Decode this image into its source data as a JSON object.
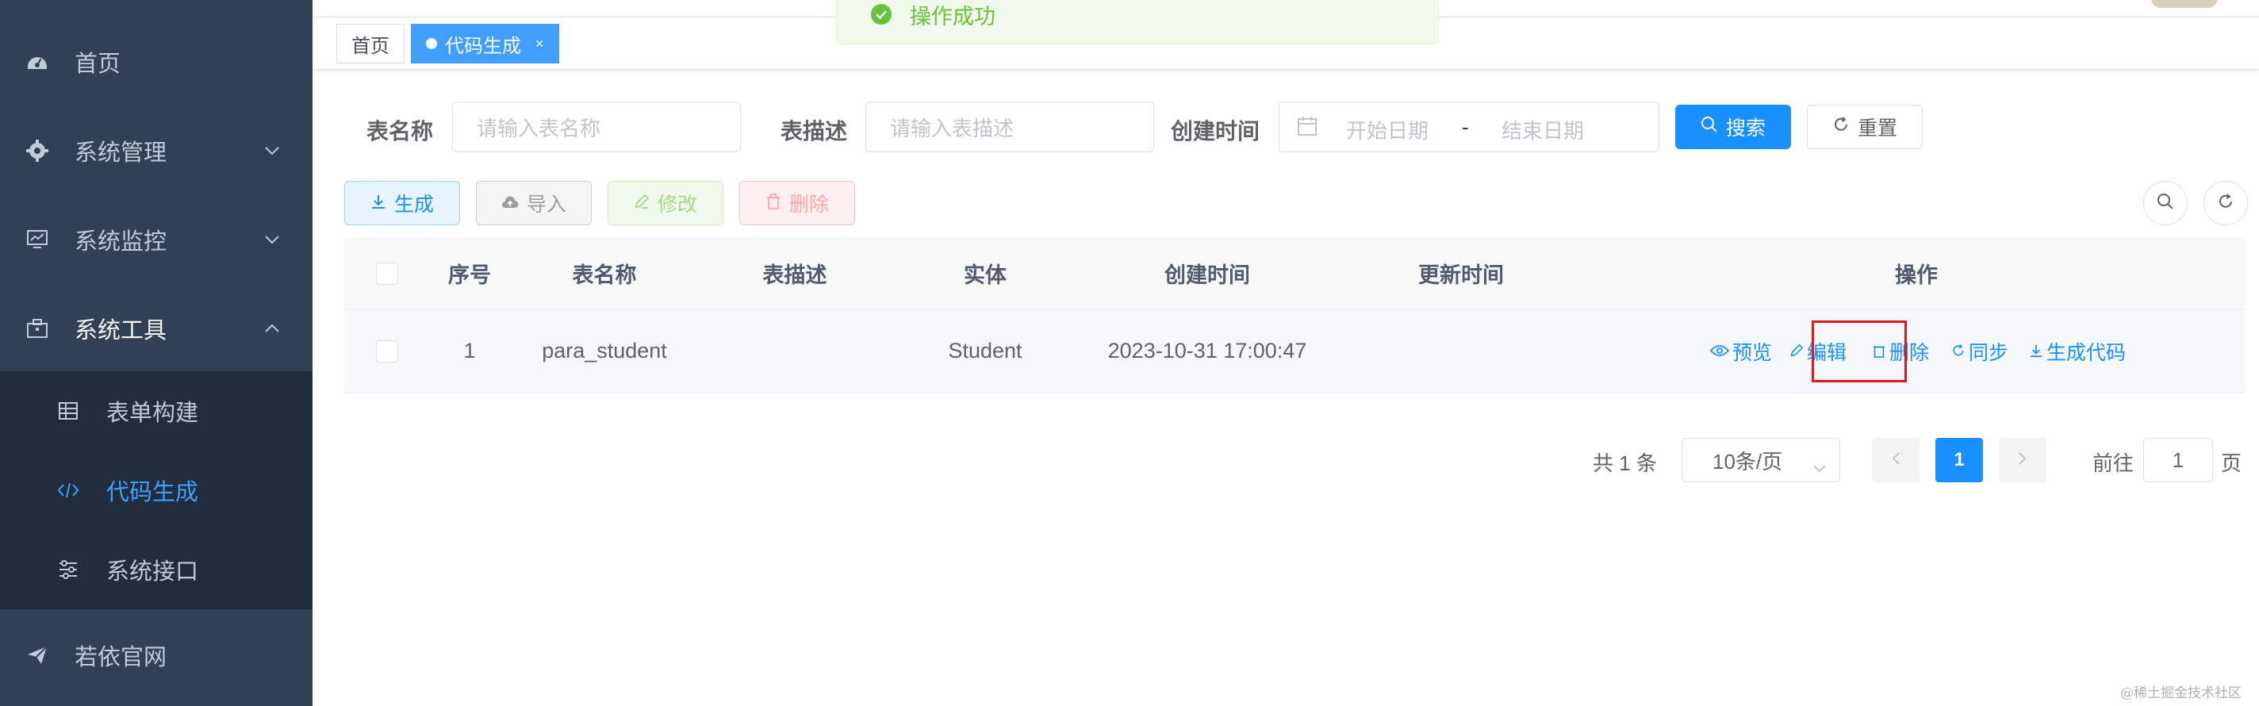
{
  "sidebar": {
    "items": [
      {
        "label": "首页",
        "icon": "dashboard-icon"
      },
      {
        "label": "系统管理",
        "icon": "gear-icon"
      },
      {
        "label": "系统监控",
        "icon": "monitor-icon"
      },
      {
        "label": "系统工具",
        "icon": "toolbox-icon"
      },
      {
        "label": "若依官网",
        "icon": "send-icon"
      }
    ],
    "submenu": [
      {
        "label": "表单构建",
        "icon": "table-grid-icon"
      },
      {
        "label": "代码生成",
        "icon": "code-icon",
        "active": true
      },
      {
        "label": "系统接口",
        "icon": "sliders-icon"
      }
    ]
  },
  "tags": {
    "home": "首页",
    "current": "代码生成",
    "close": "×"
  },
  "toast": {
    "message": "操作成功"
  },
  "search": {
    "table_name_label": "表名称",
    "table_name_placeholder": "请输入表名称",
    "table_desc_label": "表描述",
    "table_desc_placeholder": "请输入表描述",
    "create_time_label": "创建时间",
    "start_date": "开始日期",
    "separator": "-",
    "end_date": "结束日期",
    "search_btn": "搜索",
    "reset_btn": "重置"
  },
  "toolbar": {
    "generate": "生成",
    "import": "导入",
    "edit": "修改",
    "delete": "删除"
  },
  "table": {
    "headers": [
      "序号",
      "表名称",
      "表描述",
      "实体",
      "创建时间",
      "更新时间",
      "操作"
    ],
    "rows": [
      {
        "index": "1",
        "table_name": "para_student",
        "table_desc": "",
        "entity": "Student",
        "create_time": "2023-10-31 17:00:47",
        "update_time": ""
      }
    ],
    "actions": {
      "preview": "预览",
      "edit": "编辑",
      "delete": "删除",
      "sync": "同步",
      "gen_code": "生成代码"
    }
  },
  "pagination": {
    "total": "共 1 条",
    "page_size": "10条/页",
    "current_page": "1",
    "goto_label": "前往",
    "goto_value": "1",
    "page_suffix": "页"
  },
  "watermark": "@稀土掘金技术社区",
  "colors": {
    "primary": "#1890ff",
    "sidebar_bg": "#304156",
    "submenu_bg": "#1f2d3d",
    "success": "#67c23a",
    "highlight": "#e5151b"
  }
}
